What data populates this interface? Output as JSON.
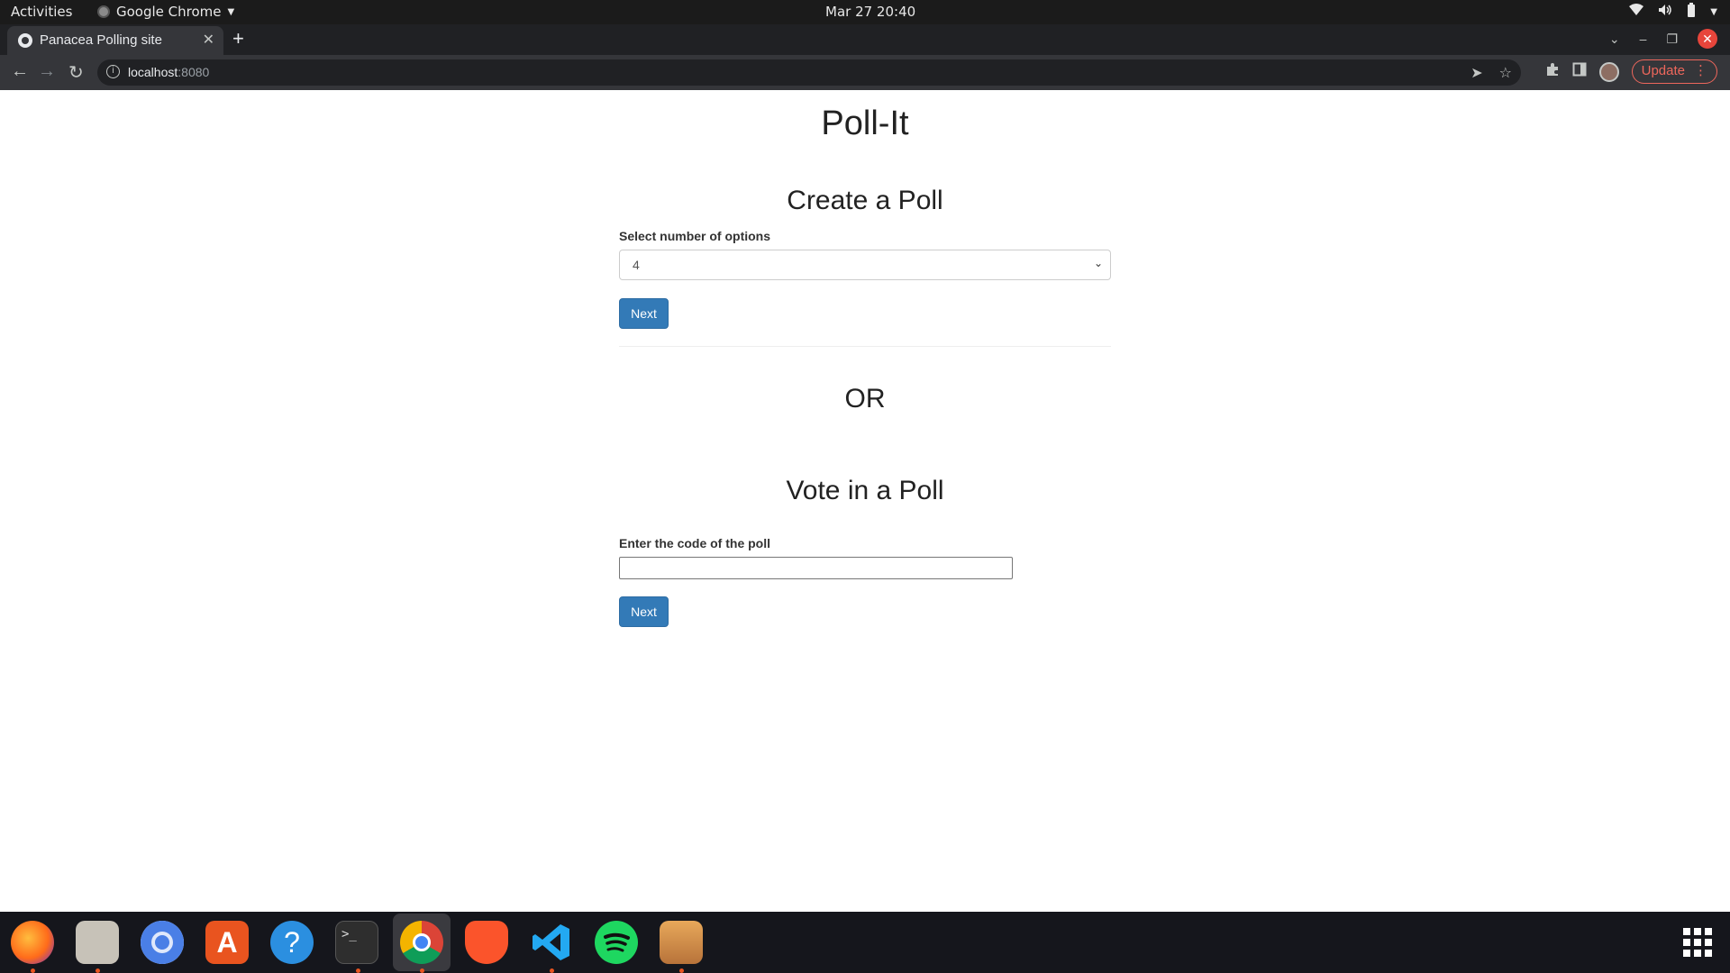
{
  "topbar": {
    "activities": "Activities",
    "app_name": "Google Chrome",
    "clock": "Mar 27  20:40"
  },
  "browser": {
    "tab_title": "Panacea Polling site",
    "url_host": "localhost",
    "url_port": ":8080",
    "update_label": "Update"
  },
  "page": {
    "site_title": "Poll-It",
    "create": {
      "heading": "Create a Poll",
      "label": "Select number of options",
      "selected_value": "4",
      "button": "Next"
    },
    "or_label": "OR",
    "vote": {
      "heading": "Vote in a Poll",
      "label": "Enter the code of the poll",
      "input_value": "",
      "button": "Next"
    }
  },
  "dock": {
    "apps": [
      "firefox-icon",
      "files-icon",
      "chromium-icon",
      "software-center-icon",
      "help-icon",
      "terminal-icon",
      "chrome-icon",
      "brave-icon",
      "vscode-icon",
      "spotify-icon",
      "package-icon"
    ]
  },
  "colors": {
    "primary_button": "#337ab7",
    "topbar": "#1b1b1b",
    "dock": "#15161c",
    "update_accent": "#ee675c"
  }
}
